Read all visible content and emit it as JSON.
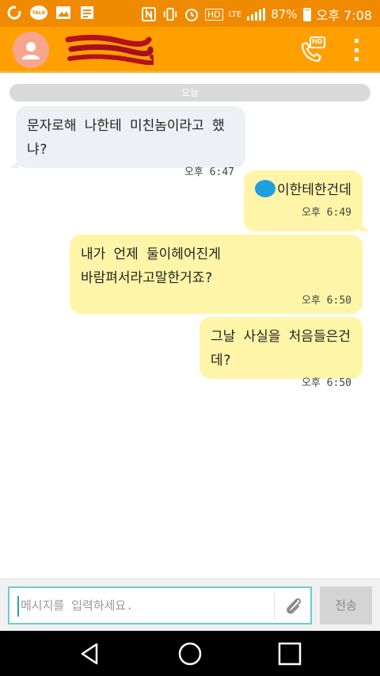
{
  "status_bar": {
    "battery": "87%",
    "time": "오후 7:08",
    "network": "LTE",
    "talk_badge": "TALK",
    "hd_badge": "HD"
  },
  "header": {
    "call_badge": "HD"
  },
  "chat": {
    "date_divider": "오늘",
    "messages": [
      {
        "direction": "incoming",
        "text": "문자로해 나한테 미친놈이라고 했냐?",
        "time": "오후 6:47"
      },
      {
        "direction": "outgoing",
        "text": "이한테한건데",
        "time": "오후 6:49"
      },
      {
        "direction": "outgoing",
        "text": "내가 언제 둘이헤어진게\n바람펴서라고말한거죠?",
        "time": "오후 6:50"
      },
      {
        "direction": "outgoing",
        "text": "그날 사실을 처음들은건데?",
        "time": "오후 6:50"
      }
    ]
  },
  "input": {
    "placeholder": "메시지를 입력하세요.",
    "send_label": "전송"
  },
  "colors": {
    "header": "#ffa000",
    "status_bar": "#f08a00",
    "incoming_bubble": "#edf0f4",
    "outgoing_bubble": "#fff5a8",
    "input_focus": "#6dcad8"
  },
  "icons": {
    "status_left": [
      "kakao-icon",
      "talk-icon",
      "image-icon",
      "notes-icon"
    ],
    "status_right": [
      "nfc-icon",
      "vibrate-icon",
      "alarm-icon",
      "hd-icon",
      "lte-icon",
      "signal-icon",
      "battery-icon"
    ],
    "header": [
      "avatar-icon",
      "hd-voice-call-icon",
      "more-menu-icon"
    ],
    "input": [
      "paperclip-icon"
    ],
    "nav": [
      "back-icon",
      "home-icon",
      "recents-icon"
    ]
  }
}
